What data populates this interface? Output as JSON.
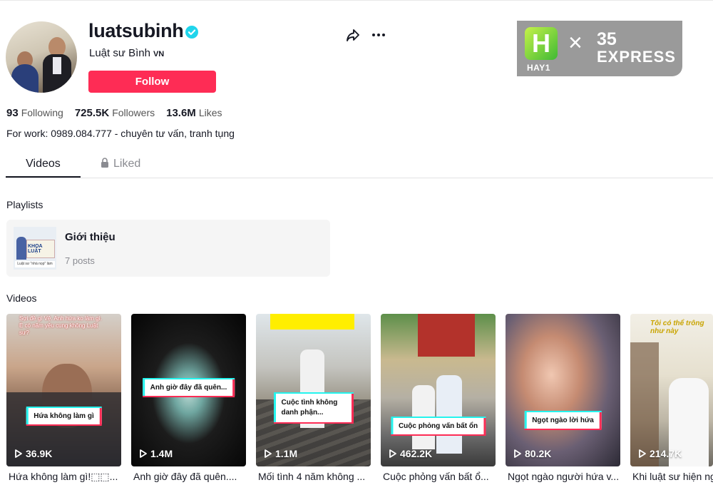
{
  "profile": {
    "username": "luatsubinh",
    "nickname": "Luật sư Bình",
    "country_code": "VN",
    "follow_label": "Follow",
    "bio": "For work: 0989.084.777 - chuyên tư vấn, tranh tụng"
  },
  "stats": {
    "following_value": "93",
    "following_label": "Following",
    "followers_value": "725.5K",
    "followers_label": "Followers",
    "likes_value": "13.6M",
    "likes_label": "Likes"
  },
  "watermark": {
    "h_letter": "H",
    "sub": "HAY1",
    "times": "×",
    "number": "35",
    "brand": "EXPRESS"
  },
  "tabs": {
    "videos_label": "Videos",
    "liked_label": "Liked"
  },
  "playlists": {
    "section_title": "Playlists",
    "items": [
      {
        "title": "Giới thiệu",
        "count": "7 posts",
        "thumb_text": "KHOA LUẬT",
        "thumb_caption": "Luật sư \"nhà nọp\" làm"
      }
    ]
  },
  "videos": {
    "section_title": "Videos",
    "items": [
      {
        "caption": "Hứa không làm gì",
        "top_text": "Sợi đề gì Vệ. Anh hứa ko làm gì. E có năm yêu cung không Luật sư?",
        "views": "36.9K",
        "title": "Hứa không làm gì!⬚⬚..."
      },
      {
        "caption": "Anh giờ đây đã quên...",
        "views": "1.4M",
        "title": "Anh giờ đây đã quên...."
      },
      {
        "caption": "Cuộc tình không danh phận...",
        "views": "1.1M",
        "title": "Mối tình 4 năm không ..."
      },
      {
        "caption": "Cuộc phỏng vấn bất ổn",
        "views": "462.2K",
        "title": "Cuộc phỏng vấn bất ổ..."
      },
      {
        "caption": "Ngọt ngào lời hứa",
        "views": "80.2K",
        "title": "Ngọt ngào người hứa v..."
      },
      {
        "top_text": "Tôi có thể trông như này",
        "views": "214.7K",
        "title": "Khi luật sư hiện ng..."
      }
    ]
  },
  "colors": {
    "follow_button": "#fe2c55",
    "verified_badge": "#20d5ec",
    "caption_cyan": "#25f4ee",
    "caption_red": "#fe2c55",
    "text_primary": "#161823",
    "text_secondary": "#8a8b91"
  },
  "icons": {
    "share": "share-arrow-icon",
    "more": "more-horizontal-icon",
    "verified": "verified-check-icon",
    "lock": "lock-icon",
    "play": "play-icon"
  }
}
